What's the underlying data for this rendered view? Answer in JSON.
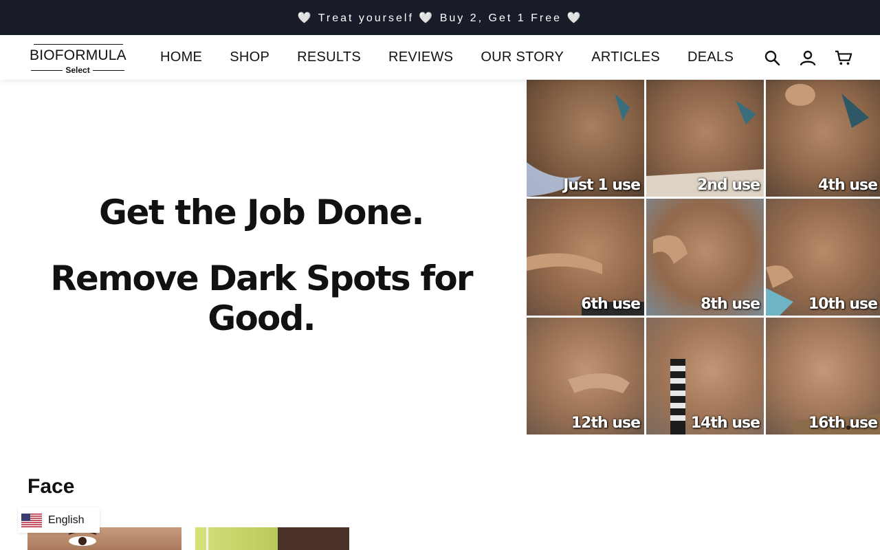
{
  "announcement": {
    "text": "🤍 Treat yourself 🤍 Buy 2, Get 1 Free 🤍"
  },
  "logo": {
    "main": "BIOFORMULA",
    "sub": "Select"
  },
  "nav": {
    "items": [
      {
        "label": "HOME"
      },
      {
        "label": "SHOP"
      },
      {
        "label": "RESULTS"
      },
      {
        "label": "REVIEWS"
      },
      {
        "label": "OUR STORY"
      },
      {
        "label": "ARTICLES"
      },
      {
        "label": "DEALS"
      }
    ]
  },
  "header_icons": [
    "search-icon",
    "account-icon",
    "cart-icon"
  ],
  "hero": {
    "line1": "Get the Job Done.",
    "line2": "Remove Dark Spots for Good.",
    "grid_labels": [
      "Just 1 use",
      "2nd use",
      "4th use",
      "6th use",
      "8th use",
      "10th use",
      "12th use",
      "14th use",
      "16th use"
    ]
  },
  "section": {
    "title": "Face"
  },
  "language": {
    "label": "English",
    "flag": "us-flag-icon"
  },
  "colors": {
    "announcement_bg": "#171c28",
    "text": "#111111",
    "background": "#ffffff"
  }
}
